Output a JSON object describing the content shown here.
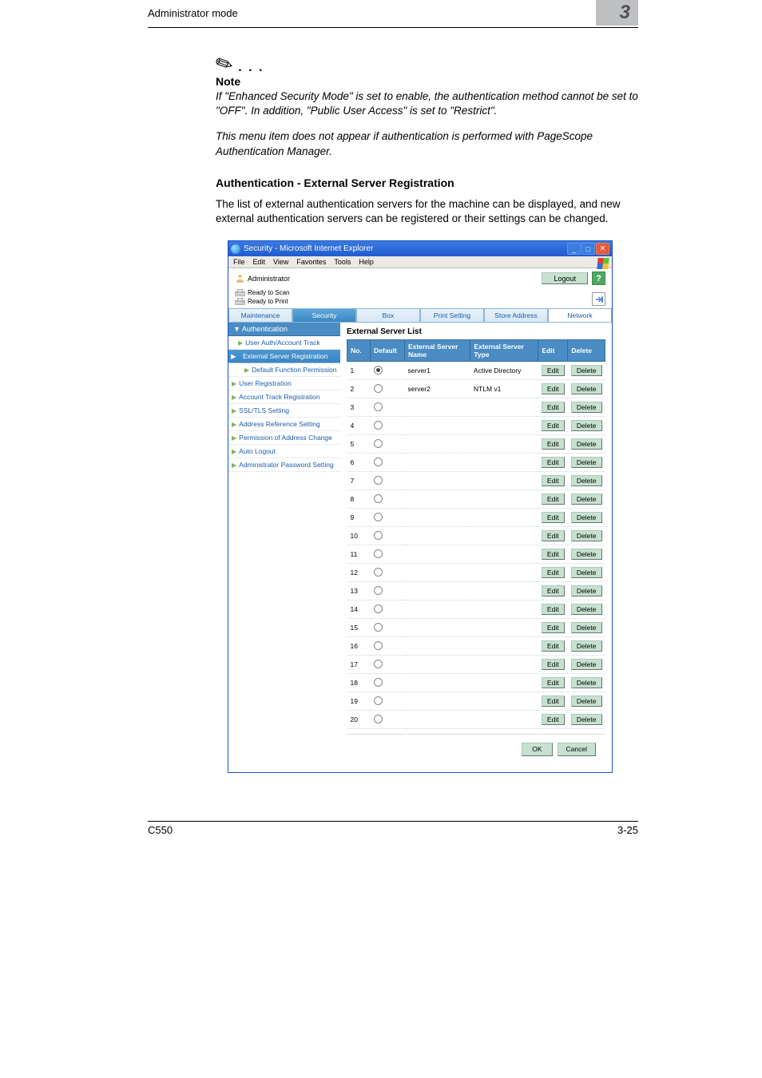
{
  "page": {
    "header_left": "Administrator mode",
    "header_right": "3",
    "footer_left": "C550",
    "footer_right": "3-25"
  },
  "note": {
    "label": "Note",
    "para1": "If \"Enhanced Security Mode\" is set to enable, the authentication method cannot be set to \"OFF\". In addition, \"Public User Access\" is set to \"Restrict\".",
    "para2": "This menu item does not appear if authentication is performed with PageScope Authentication Manager."
  },
  "section": {
    "title": "Authentication - External Server Registration",
    "body": "The list of external authentication servers for the machine can be displayed, and new external authentication servers can be registered or their settings can be changed."
  },
  "ie": {
    "title": "Security - Microsoft Internet Explorer",
    "menus": [
      "File",
      "Edit",
      "View",
      "Favorites",
      "Tools",
      "Help"
    ]
  },
  "topbar": {
    "admin": "Administrator",
    "logout": "Logout",
    "status1": "Ready to Scan",
    "status2": "Ready to Print"
  },
  "tabs": [
    "Maintenance",
    "Security",
    "Box",
    "Print Setting",
    "Store Address",
    "Network"
  ],
  "sidebar": {
    "auth_header": "Authentication",
    "items": [
      "User Auth/Account Track",
      "External Server Registration",
      "Default Function Permission",
      "User Registration",
      "Account Track Registration",
      "SSL/TLS Setting",
      "Address Reference Setting",
      "Permission of Address Change",
      "Auto Logout",
      "Administrator Password Setting"
    ]
  },
  "content": {
    "title": "External Server List",
    "cols": {
      "no": "No.",
      "def": "Default",
      "name": "External Server Name",
      "type": "External Server Type",
      "edit": "Edit",
      "del": "Delete"
    },
    "edit_label": "Edit",
    "del_label": "Delete",
    "rows": [
      {
        "no": "1",
        "name": "server1",
        "type": "Active Directory",
        "sel": true
      },
      {
        "no": "2",
        "name": "server2",
        "type": "NTLM v1",
        "sel": false
      },
      {
        "no": "3",
        "name": "",
        "type": "",
        "sel": false
      },
      {
        "no": "4",
        "name": "",
        "type": "",
        "sel": false
      },
      {
        "no": "5",
        "name": "",
        "type": "",
        "sel": false
      },
      {
        "no": "6",
        "name": "",
        "type": "",
        "sel": false
      },
      {
        "no": "7",
        "name": "",
        "type": "",
        "sel": false
      },
      {
        "no": "8",
        "name": "",
        "type": "",
        "sel": false
      },
      {
        "no": "9",
        "name": "",
        "type": "",
        "sel": false
      },
      {
        "no": "10",
        "name": "",
        "type": "",
        "sel": false
      },
      {
        "no": "11",
        "name": "",
        "type": "",
        "sel": false
      },
      {
        "no": "12",
        "name": "",
        "type": "",
        "sel": false
      },
      {
        "no": "13",
        "name": "",
        "type": "",
        "sel": false
      },
      {
        "no": "14",
        "name": "",
        "type": "",
        "sel": false
      },
      {
        "no": "15",
        "name": "",
        "type": "",
        "sel": false
      },
      {
        "no": "16",
        "name": "",
        "type": "",
        "sel": false
      },
      {
        "no": "17",
        "name": "",
        "type": "",
        "sel": false
      },
      {
        "no": "18",
        "name": "",
        "type": "",
        "sel": false
      },
      {
        "no": "19",
        "name": "",
        "type": "",
        "sel": false
      },
      {
        "no": "20",
        "name": "",
        "type": "",
        "sel": false
      }
    ],
    "ok": "OK",
    "cancel": "Cancel"
  }
}
